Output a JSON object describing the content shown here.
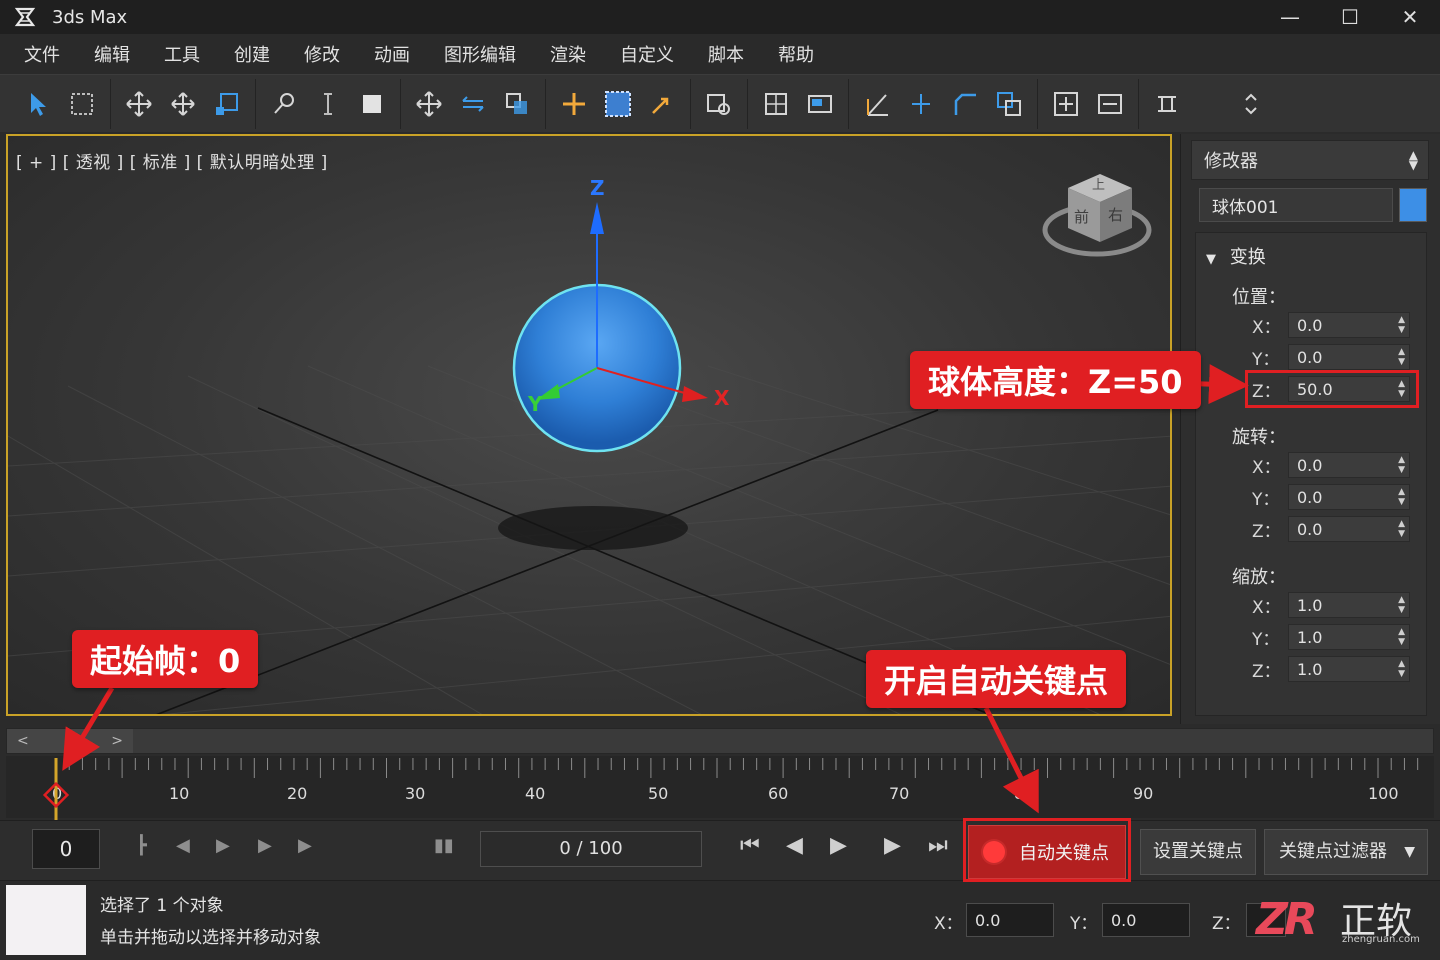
{
  "window": {
    "title": "3ds Max",
    "controls": [
      "—",
      "☐",
      "✕"
    ]
  },
  "menu": [
    "文件",
    "编辑",
    "工具",
    "创建",
    "修改",
    "动画",
    "图形编辑",
    "渲染",
    "自定义",
    "脚本",
    "帮助"
  ],
  "viewport": {
    "label": "[ + ] [ 透视 ] [ 标准 ] [ 默认明暗处理 ]",
    "axes": {
      "x": "X",
      "y": "Y",
      "z": "Z"
    },
    "viewcube": {
      "top": "上",
      "front": "前",
      "right": "右"
    },
    "border_color": "#c9a227",
    "sphere_color": "#2f7fd6"
  },
  "panel": {
    "modifier_list": "修改器",
    "object_name": "球体001",
    "object_color": "#3d8fe6",
    "rollout_title": "变换",
    "position": {
      "label": "位置：",
      "x": "0.0",
      "y": "0.0",
      "z": "50.0"
    },
    "rotation": {
      "label": "旋转：",
      "x": "0.0",
      "y": "0.0",
      "z": "0.0"
    },
    "scale": {
      "label": "缩放：",
      "x": "1.0",
      "y": "1.0",
      "z": "1.0"
    },
    "axis_labels": {
      "x": "X：",
      "y": "Y：",
      "z": "Z："
    }
  },
  "timeline": {
    "ticks": [
      "0",
      "10",
      "20",
      "30",
      "40",
      "50",
      "60",
      "70",
      "80",
      "90",
      "100"
    ],
    "current_frame": "0",
    "frame_range": "0 / 100",
    "scroll_left": "<",
    "scroll_right": ">"
  },
  "controls": {
    "auto_key": "自动关键点",
    "set_key": "设置关键点",
    "key_filter": "关键点过滤器"
  },
  "status": {
    "line1": "选择了 1 个对象",
    "line2": "单击并拖动以选择并移动对象",
    "coords": {
      "x_label": "X：",
      "x": "0.0",
      "y_label": "Y：",
      "y": "0.0",
      "z_label": "Z：",
      "z": ""
    }
  },
  "annotations": {
    "sphere_height": "球体高度：Z=50",
    "start_frame": "起始帧：0",
    "auto_key": "开启自动关键点",
    "color": "#e01f22"
  },
  "watermark": {
    "logo": "ZR",
    "name": "正软",
    "url": "zhengruan.com"
  }
}
